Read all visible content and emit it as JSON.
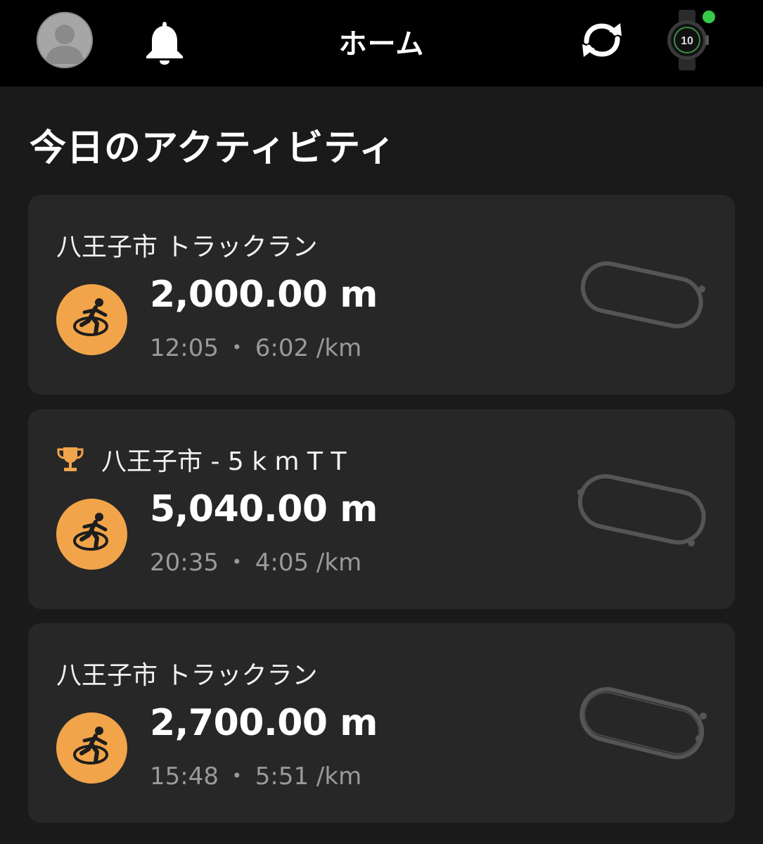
{
  "header": {
    "title": "ホーム",
    "icons": [
      "avatar-icon",
      "bell-icon",
      "sync-icon",
      "watch-icon"
    ],
    "device_status_color": "#39c94a"
  },
  "section": {
    "title": "今日のアクティビティ"
  },
  "activities": [
    {
      "name": "八王子市 トラックラン",
      "distance": "2,000.00 m",
      "time": "12:05",
      "separator": "•",
      "pace": "6:02 /km",
      "has_trophy": false
    },
    {
      "name": "八王子市 - 5 k m T T",
      "distance": "5,040.00 m",
      "time": "20:35",
      "separator": "•",
      "pace": "4:05 /km",
      "has_trophy": true
    },
    {
      "name": "八王子市 トラックラン",
      "distance": "2,700.00 m",
      "time": "15:48",
      "separator": "•",
      "pace": "5:51 /km",
      "has_trophy": false
    }
  ],
  "colors": {
    "accent": "#f2a44a",
    "card": "#272727",
    "background": "#1a1a1a",
    "route": "#555555"
  }
}
